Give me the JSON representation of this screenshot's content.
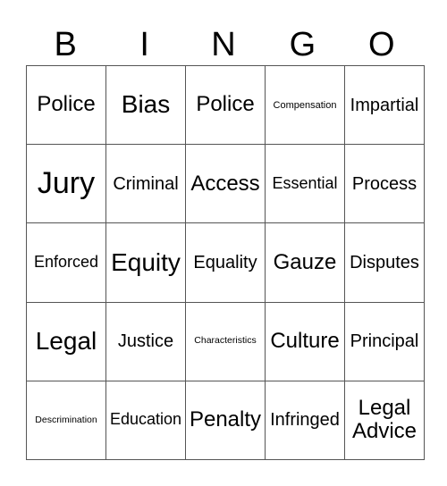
{
  "header": [
    "B",
    "I",
    "N",
    "G",
    "O"
  ],
  "rows": [
    [
      "Police",
      "Bias",
      "Police",
      "Compensation",
      "Impartial"
    ],
    [
      "Jury",
      "Criminal",
      "Access",
      "Essential",
      "Process"
    ],
    [
      "Enforced",
      "Equity",
      "Equality",
      "Gauze",
      "Disputes"
    ],
    [
      "Legal",
      "Justice",
      "Characteristics",
      "Culture",
      "Principal"
    ],
    [
      "Descrimination",
      "Education",
      "Penalty",
      "Infringed",
      "Legal Advice"
    ]
  ]
}
